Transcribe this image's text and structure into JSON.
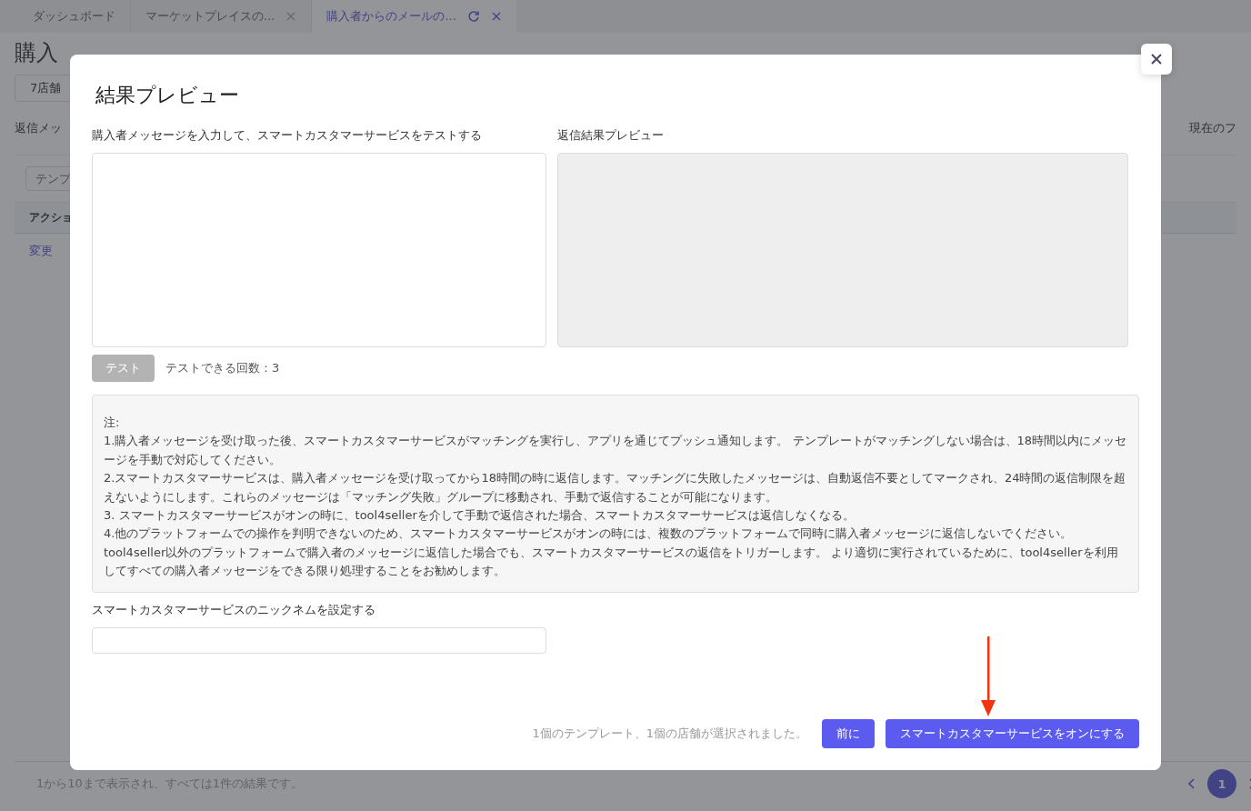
{
  "background_page": {
    "tabs": [
      {
        "label": "ダッシュボード",
        "selected": false,
        "closable": false
      },
      {
        "label": "マーケットプレイスの...",
        "selected": false,
        "closable": true
      },
      {
        "label": "購入者からのメールの...",
        "selected": true,
        "closable": true
      }
    ],
    "title": "購入",
    "store_select": "7店舗",
    "reply_label": "返信メッ",
    "current_label": "現在のフ",
    "search": {
      "placeholder": "テンプ"
    },
    "table": {
      "columns": [
        "アクショ"
      ],
      "rows": [
        [
          "変更"
        ]
      ]
    },
    "footer": "1から10まで表示され、すべては1件の結果です。",
    "pagination": {
      "pages": [
        {
          "label": "1",
          "selected": true
        }
      ]
    }
  },
  "dialog": {
    "title": "結果プレビュー",
    "input_label": "購入者メッセージを入力して、スマートカスタマーサービスをテストする",
    "preview_label": "返信結果プレビュー",
    "test_button": {
      "label": "テスト",
      "disabled": true
    },
    "test_count": "テストできる回数：3",
    "notes": {
      "heading": "注:",
      "items": [
        "1.購入者メッセージを受け取った後、スマートカスタマーサービスがマッチングを実行し、アプリを通じてプッシュ通知します。 テンプレートがマッチングしない場合は、18時間以内にメッセージを手動で対応してください。",
        "2.スマートカスタマーサービスは、購入者メッセージを受け取ってから18時間の時に返信します。マッチングに失敗したメッセージは、自動返信不要としてマークされ、24時間の返信制限を超えないようにします。これらのメッセージは「マッチング失敗」グループに移動され、手動で返信することが可能になります。",
        "3. スマートカスタマーサービスがオンの時に、tool4sellerを介して手動で返信された場合、スマートカスタマーサービスは返信しなくなる。",
        "4.他のプラットフォームでの操作を判明できないのため、スマートカスタマーサービスがオンの時には、複数のプラットフォームで同時に購入者メッセージに返信しないでください。 tool4seller以外のプラットフォームで購入者のメッセージに返信した場合でも、スマートカスタマーサービスの返信をトリガーします。 より適切に実行されているために、tool4sellerを利用してすべての購入者メッセージをできる限り処理することをお勧めします。"
      ]
    },
    "nickname_label": "スマートカスタマーサービスのニックネムを設定する",
    "status": "1個のテンプレート、1個の店舗が選択されました。",
    "buttons": [
      {
        "label": "前に"
      },
      {
        "label": "スマートカスタマーサービスをオンにする"
      }
    ]
  }
}
